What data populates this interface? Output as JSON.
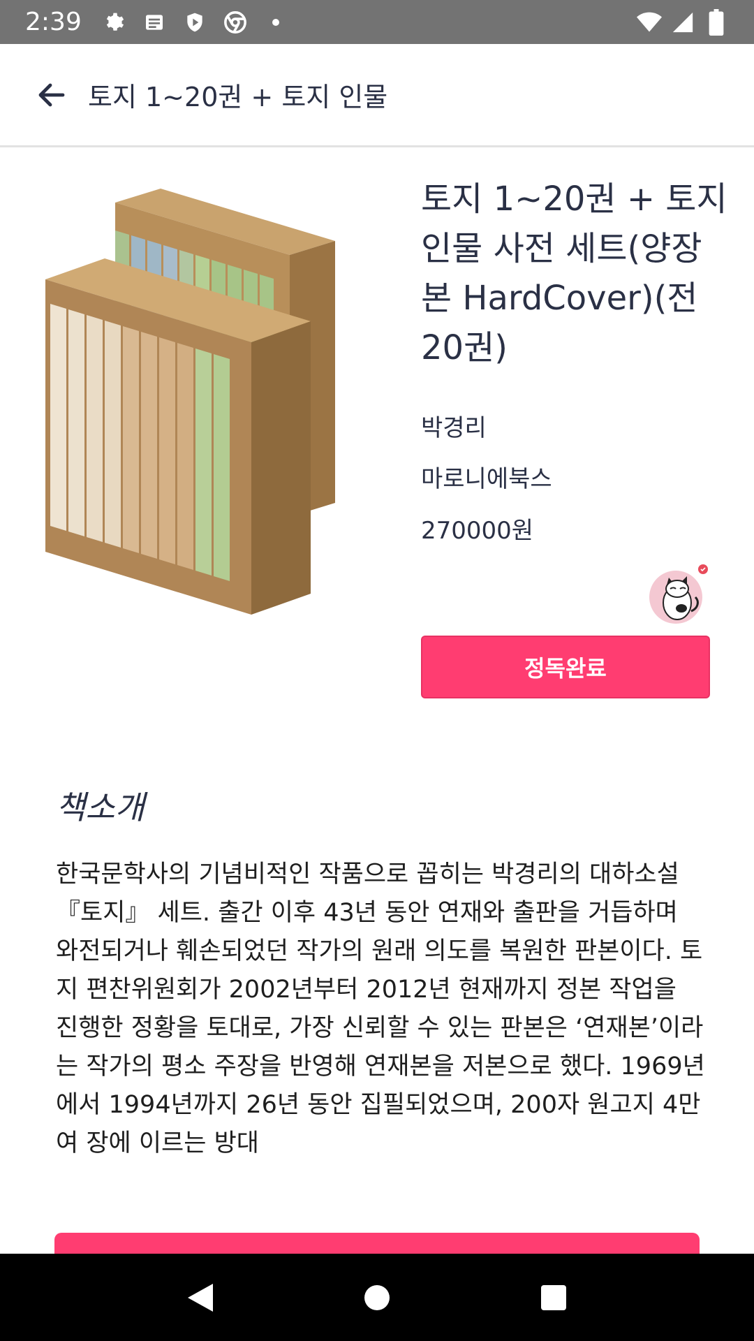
{
  "status_bar": {
    "time": "2:39",
    "icons": [
      "settings-icon",
      "message-icon",
      "shield-icon",
      "chrome-icon",
      "dot-icon"
    ],
    "right_icons": [
      "wifi-icon",
      "signal-icon",
      "battery-icon"
    ]
  },
  "app_bar": {
    "title": "토지 1~20권 + 토지 인물",
    "back_icon": "arrow-left-icon"
  },
  "product": {
    "title": "토지 1~20권 + 토지 인물 사전 세트(양장본 HardCover)(전20권)",
    "author": "박경리",
    "publisher": "마로니에북스",
    "price": "270000원",
    "subscribe_label": "정독완료"
  },
  "description": {
    "heading": "책소개",
    "body": "한국문학사의 기념비적인 작품으로 꼽히는 박경리의 대하소설 『토지』 세트. 출간 이후 43년 동안 연재와 출판을 거듭하며 와전되거나 훼손되었던 작가의 원래 의도를 복원한 판본이다. 토지 편찬위원회가 2002년부터 2012년 현재까지 정본 작업을 진행한 정황을 토대로, 가장 신뢰할 수 있는 판본은 ‘연재본’이라는 작가의 평소 주장을 반영해 연재본을 저본으로 했다. 1969년에서 1994년까지 26년 동안 집필되었으며, 200자 원고지 4만여 장에 이르는 방대"
  },
  "colors": {
    "accent": "#ff3d71",
    "status_bar": "#737373",
    "text": "#2a3045"
  },
  "nav_bar": [
    "back-triangle-icon",
    "home-circle-icon",
    "recents-square-icon"
  ]
}
